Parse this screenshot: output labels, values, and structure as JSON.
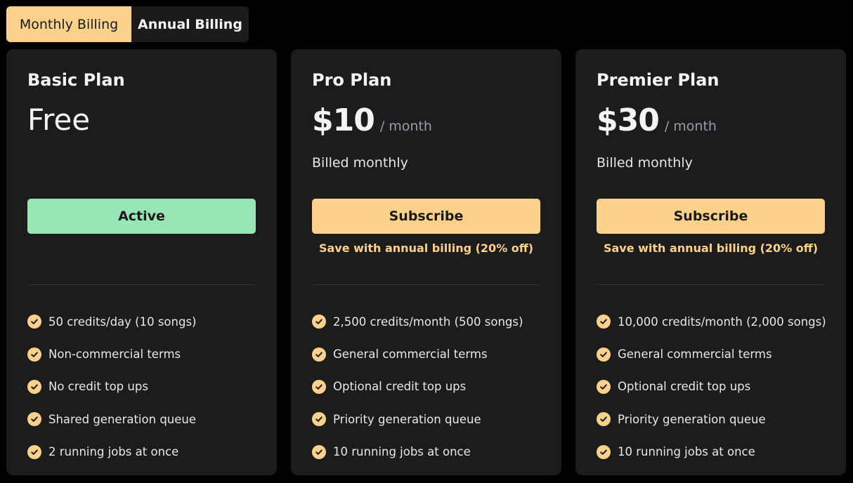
{
  "billing_toggle": {
    "monthly_label": "Monthly Billing",
    "annual_label": "Annual Billing",
    "selected": "monthly"
  },
  "colors": {
    "accent": "#fcd18c",
    "active": "#98e6b5",
    "card_bg": "#1c1c1c",
    "page_bg": "#000000"
  },
  "plans": [
    {
      "name": "Basic Plan",
      "price": "Free",
      "button_label": "Active",
      "features": [
        "50 credits/day (10 songs)",
        "Non-commercial terms",
        "No credit top ups",
        "Shared generation queue",
        "2 running jobs at once"
      ]
    },
    {
      "name": "Pro Plan",
      "price": "$10",
      "price_unit": "/ month",
      "billed": "Billed monthly",
      "button_label": "Subscribe",
      "save_note": "Save with annual billing (20% off)",
      "features": [
        "2,500 credits/month (500 songs)",
        "General commercial terms",
        "Optional credit top ups",
        "Priority generation queue",
        "10 running jobs at once"
      ]
    },
    {
      "name": "Premier Plan",
      "price": "$30",
      "price_unit": "/ month",
      "billed": "Billed monthly",
      "button_label": "Subscribe",
      "save_note": "Save with annual billing (20% off)",
      "features": [
        "10,000 credits/month (2,000 songs)",
        "General commercial terms",
        "Optional credit top ups",
        "Priority generation queue",
        "10 running jobs at once"
      ]
    }
  ]
}
